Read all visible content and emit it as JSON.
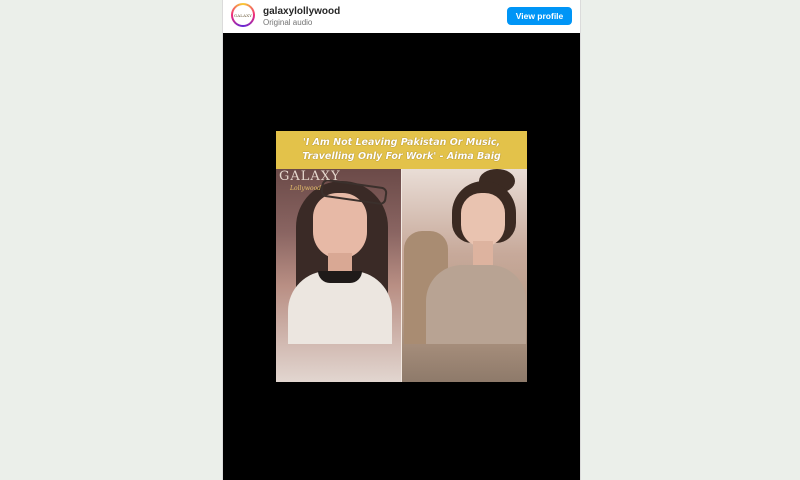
{
  "header": {
    "username": "galaxylollywood",
    "subline": "Original audio",
    "view_profile_label": "View profile",
    "avatar_text": "GALAXY"
  },
  "video": {
    "banner_lines": [
      "'I Am Not Leaving Pakistan Or Music,",
      "Travelling Only For Work'  - Aima Baig"
    ],
    "watermark": "GALAXY",
    "watermark_sub": "Lollywood"
  },
  "colors": {
    "accent": "#0095f6",
    "banner": "#e3c24a",
    "page_background": "#ebefea"
  }
}
